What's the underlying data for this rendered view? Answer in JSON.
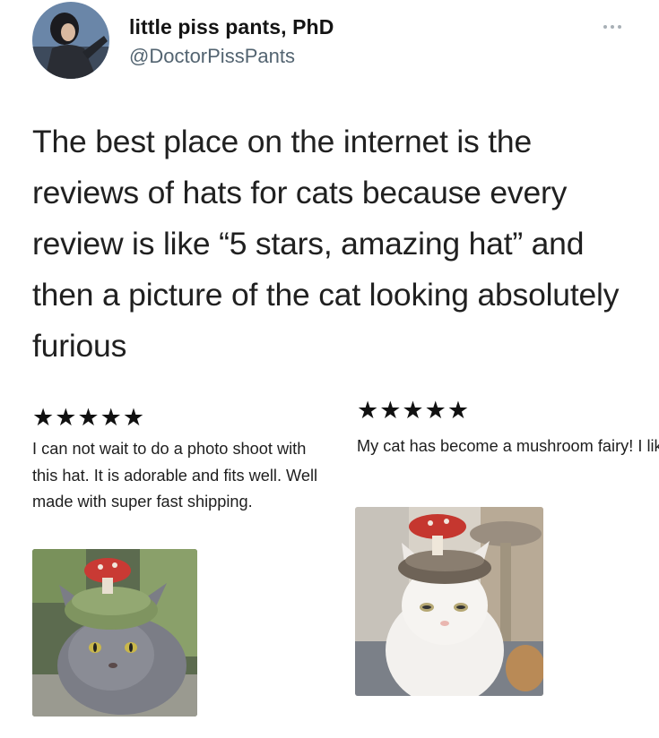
{
  "tweet": {
    "display_name": "little piss pants, PhD",
    "handle": "@DoctorPissPants",
    "more_icon": "more-horizontal-icon",
    "text": "The best place on the internet is the reviews of hats for cats because every review is like “5 stars, amazing hat” and then a picture of the cat looking absolutely furious"
  },
  "reviews": [
    {
      "stars_text": "★★★★★",
      "rating": 5,
      "text": "I can not wait to do a photo shoot with this hat. It is adorable and fits well. Well made with super fast shipping."
    },
    {
      "stars_text": "★★★★★",
      "rating": 5,
      "text": "My cat has become a mushroom fairy! I like it very cute."
    }
  ]
}
